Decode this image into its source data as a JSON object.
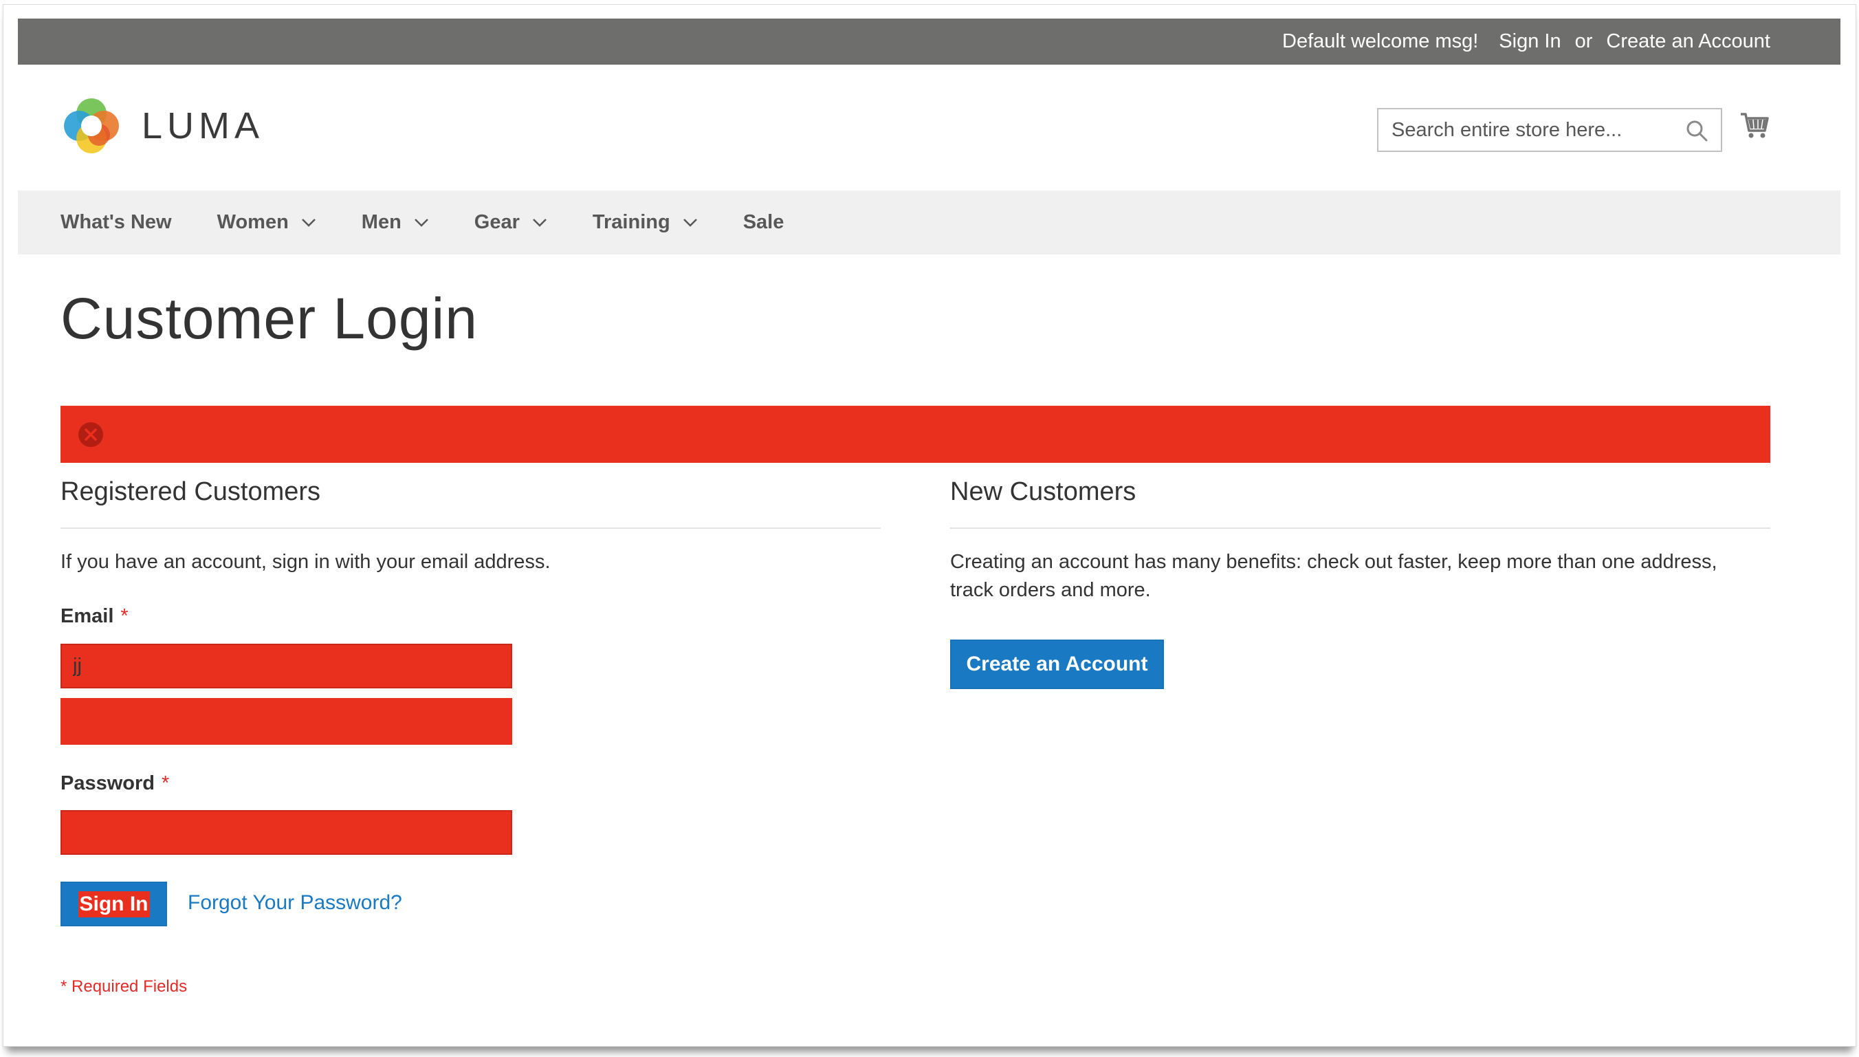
{
  "colors": {
    "panel_bg": "#6e6e6c",
    "accent_blue": "#1979c3",
    "error_red": "#e9301f",
    "required_red": "#e02b27",
    "nav_bg": "#f0f0f0"
  },
  "panel": {
    "welcome": "Default welcome msg!",
    "sign_in": "Sign In",
    "or": "or",
    "create_account": "Create an Account"
  },
  "header": {
    "logo_text": "LUMA",
    "search_placeholder": "Search entire store here...",
    "search_icon": "search-icon",
    "cart_icon": "cart-icon"
  },
  "nav": {
    "items": [
      {
        "label": "What's New",
        "has_dropdown": false
      },
      {
        "label": "Women",
        "has_dropdown": true
      },
      {
        "label": "Men",
        "has_dropdown": true
      },
      {
        "label": "Gear",
        "has_dropdown": true
      },
      {
        "label": "Training",
        "has_dropdown": true
      },
      {
        "label": "Sale",
        "has_dropdown": false
      }
    ]
  },
  "page": {
    "title": "Customer Login"
  },
  "error_message": {
    "icon": "error-x-icon"
  },
  "registered": {
    "title": "Registered Customers",
    "intro": "If you have an account, sign in with your email address.",
    "email_label": "Email",
    "email_value": "jj",
    "password_label": "Password",
    "required_mark": "*",
    "sign_in_button": "Sign In",
    "forgot_link": "Forgot Your Password?",
    "required_note": "* Required Fields"
  },
  "new_customers": {
    "title": "New Customers",
    "intro": "Creating an account has many benefits: check out faster, keep more than one address, track orders and more.",
    "create_button": "Create an Account"
  }
}
